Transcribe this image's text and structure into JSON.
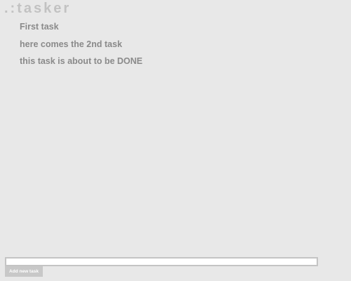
{
  "app": {
    "title": ".:tasker"
  },
  "tasks": [
    {
      "label": "First task"
    },
    {
      "label": "here comes the 2nd task"
    },
    {
      "label": "this task is about to be DONE"
    }
  ],
  "new_task": {
    "value": "",
    "placeholder": "",
    "add_label": "Add new task"
  },
  "colors": {
    "background": "#e8e8e8",
    "title": "#c2c2c2",
    "task_text": "#8a8a8a",
    "button_bg": "#c8c8c8",
    "input_border": "#c4c4c4"
  }
}
